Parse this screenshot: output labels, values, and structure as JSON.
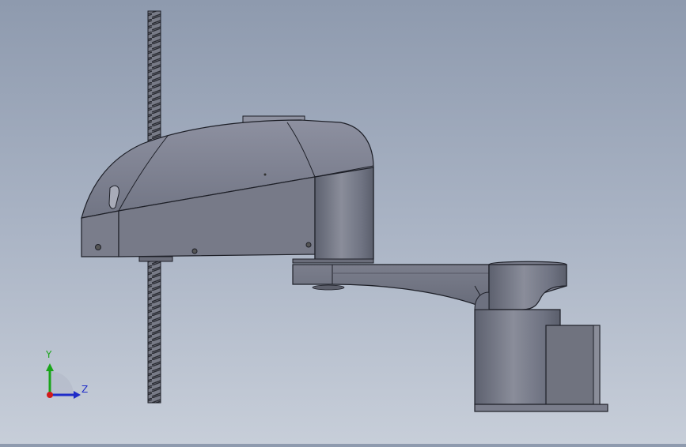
{
  "viewport": {
    "background_top": "#8e9aae",
    "background_bottom": "#c7ced9",
    "model_color": "#6f7382",
    "model_highlight": "#a0a3b0",
    "edge_color": "#1d1f27"
  },
  "triad": {
    "y_label": "Y",
    "z_label": "Z",
    "y_color": "#1aa51a",
    "z_color": "#1f2cc8",
    "origin_color": "#d11a1a"
  }
}
